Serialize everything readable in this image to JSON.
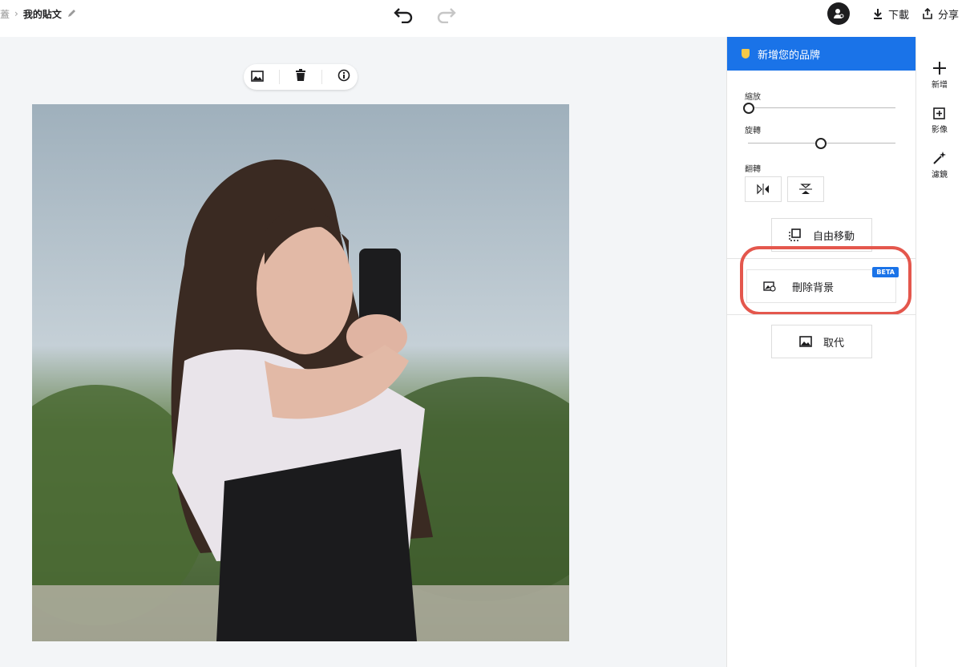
{
  "topbar": {
    "breadcrumb_home": "蓋",
    "breadcrumb_sep": "›",
    "doc_title": "我的貼文",
    "download_label": "下載",
    "share_label": "分享"
  },
  "panel": {
    "brand_title": "新增您的品牌",
    "zoom_label": "縮放",
    "zoom_value": 0,
    "rotate_label": "旋轉",
    "rotate_value": 0.5,
    "flip_label": "翻轉",
    "free_move_label": "自由移動",
    "remove_bg_label": "刪除背景",
    "beta_badge": "BETA",
    "replace_label": "取代"
  },
  "rail": {
    "add_label": "新增",
    "image_label": "影像",
    "filter_label": "濾鏡"
  },
  "colors": {
    "accent": "#1a73e8",
    "highlight": "#e4574d",
    "brand_shield": "#f7c948"
  }
}
